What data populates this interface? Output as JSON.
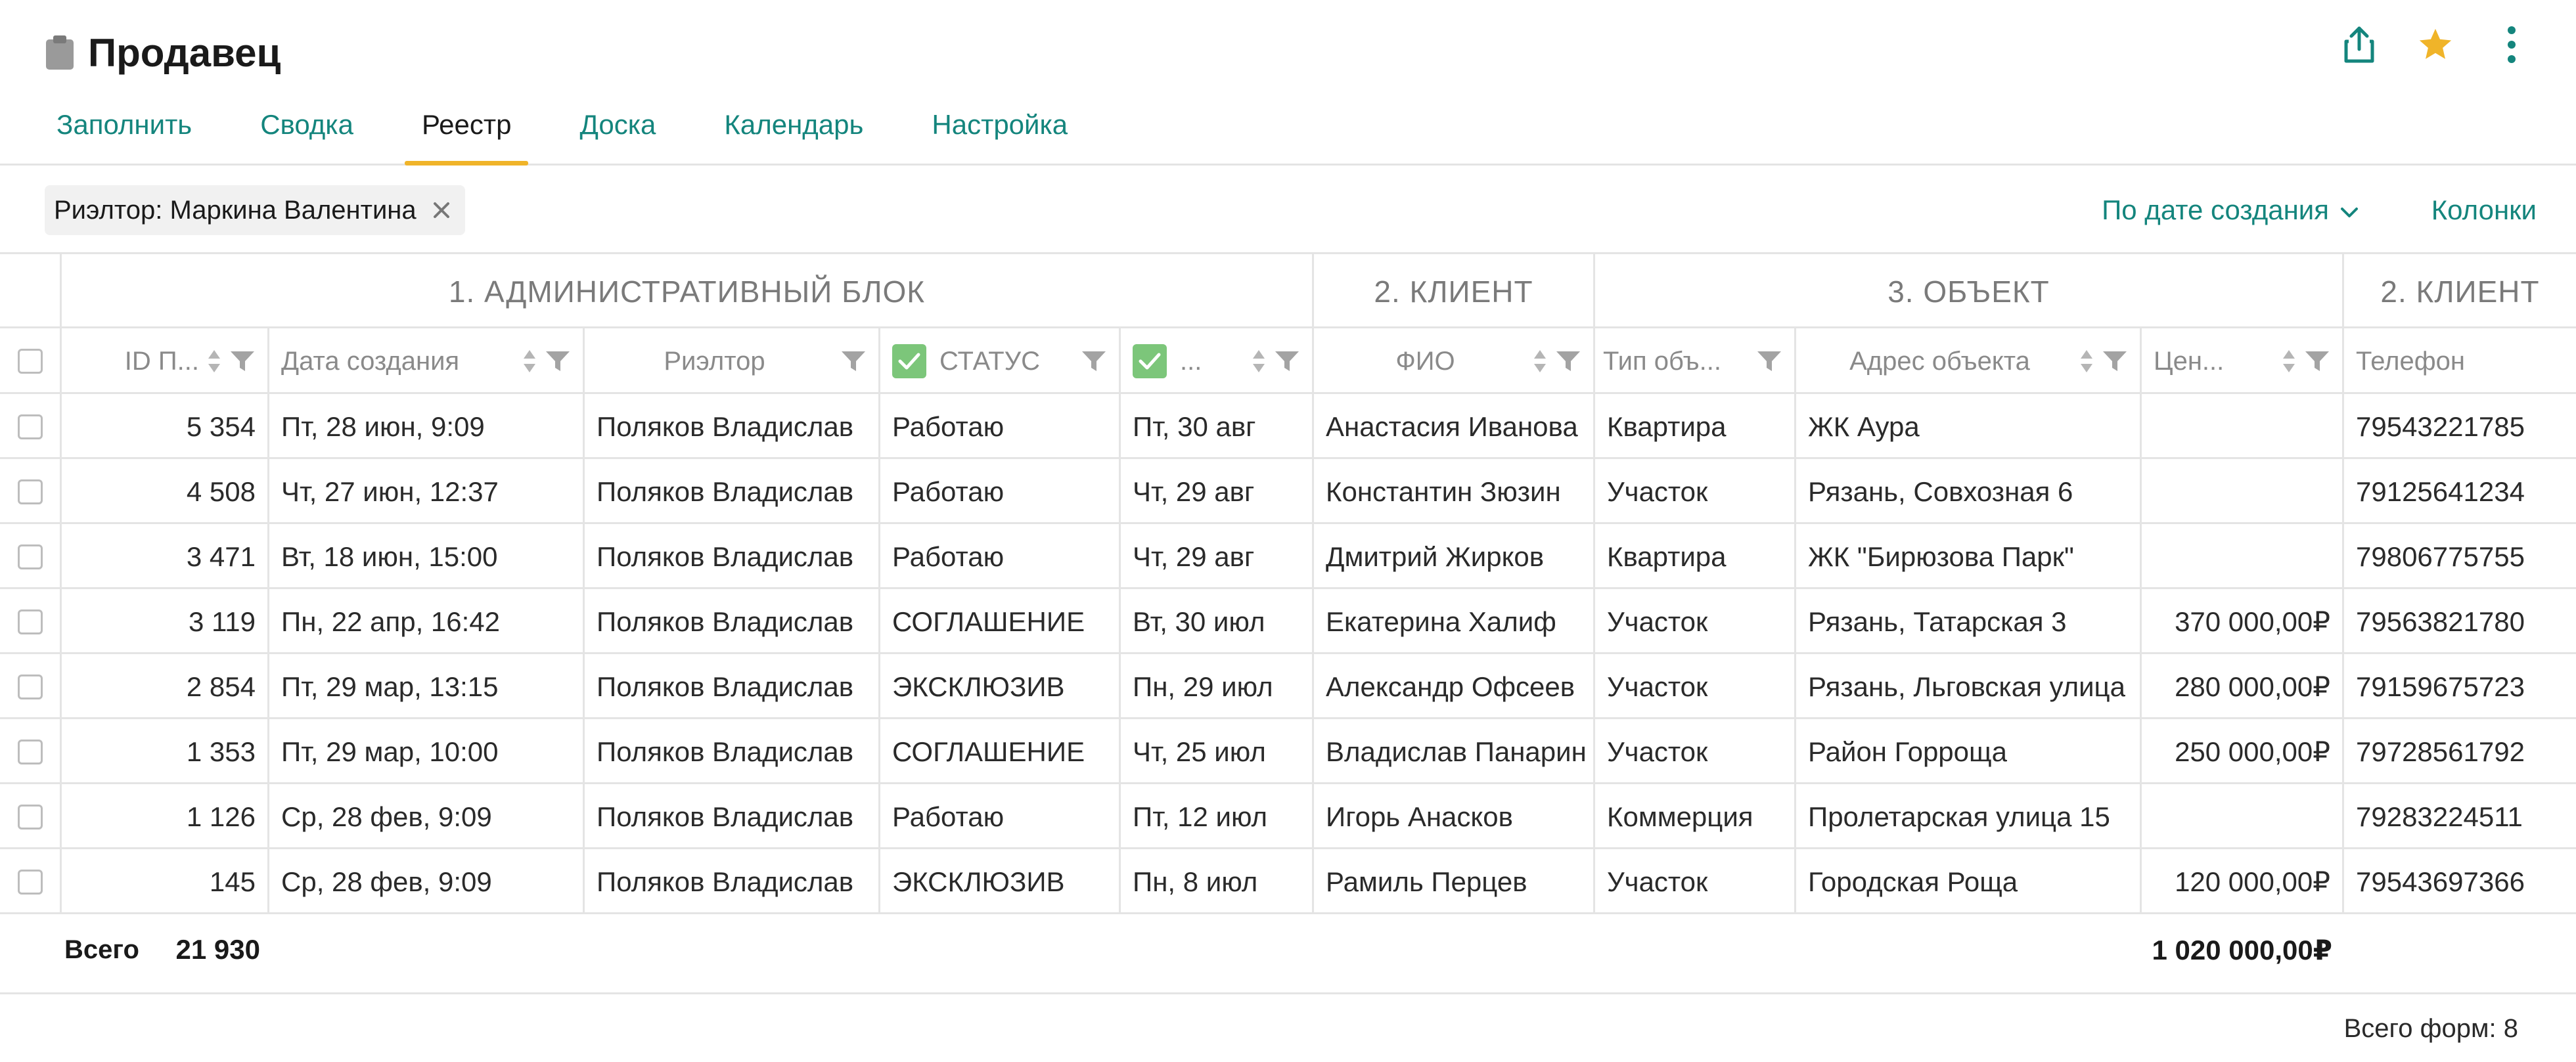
{
  "app": {
    "title": "Продавец",
    "tabs": [
      {
        "label": "Заполнить"
      },
      {
        "label": "Сводка"
      },
      {
        "label": "Реестр"
      },
      {
        "label": "Доска"
      },
      {
        "label": "Календарь"
      },
      {
        "label": "Настройка"
      }
    ],
    "active_tab": "Реестр",
    "accent_color": "#14857d",
    "tab_indicator_color": "#f0b429",
    "star_color": "#f0b429"
  },
  "toolbar": {
    "filter_chip": "Риэлтор: Маркина Валентина",
    "sort_label": "По дате создания",
    "columns_label": "Колонки"
  },
  "table": {
    "groups": [
      {
        "label": "1. АДМИНИСТРАТИВНЫЙ БЛОК"
      },
      {
        "label": "2. КЛИЕНТ"
      },
      {
        "label": "3. ОБЪЕКТ"
      },
      {
        "label": "2. КЛИЕНТ"
      }
    ],
    "columns": [
      {
        "label": "ID П..."
      },
      {
        "label": "Дата создания"
      },
      {
        "label": "Риэлтор"
      },
      {
        "label": "СТАТУС"
      },
      {
        "label": "..."
      },
      {
        "label": "ФИО"
      },
      {
        "label": "Тип объ..."
      },
      {
        "label": "Адрес объекта"
      },
      {
        "label": "Цен..."
      },
      {
        "label": "Телефон"
      }
    ],
    "rows": [
      {
        "id": "5 354",
        "created": "Пт, 28 июн, 9:09",
        "realtor": "Поляков Владислав",
        "status": "Работаю",
        "date2": "Пт, 30 авг",
        "fio": "Анастасия Иванова",
        "type": "Квартира",
        "address": "ЖК Аура",
        "price": "",
        "phone": "79543221785"
      },
      {
        "id": "4 508",
        "created": "Чт, 27 июн, 12:37",
        "realtor": "Поляков Владислав",
        "status": "Работаю",
        "date2": "Чт, 29 авг",
        "fio": "Константин Зюзин",
        "type": "Участок",
        "address": "Рязань, Совхозная 6",
        "price": "",
        "phone": "79125641234"
      },
      {
        "id": "3 471",
        "created": "Вт, 18 июн, 15:00",
        "realtor": "Поляков Владислав",
        "status": "Работаю",
        "date2": "Чт, 29 авг",
        "fio": "Дмитрий Жирков",
        "type": "Квартира",
        "address": "ЖК \"Бирюзова Парк\"",
        "price": "",
        "phone": "79806775755"
      },
      {
        "id": "3 119",
        "created": "Пн, 22 апр, 16:42",
        "realtor": "Поляков Владислав",
        "status": "СОГЛАШЕНИЕ",
        "date2": "Вт, 30 июл",
        "fio": "Екатерина Халиф",
        "type": "Участок",
        "address": "Рязань, Татарская 3",
        "price": "370 000,00₽",
        "phone": "79563821780"
      },
      {
        "id": "2 854",
        "created": "Пт, 29 мар, 13:15",
        "realtor": "Поляков Владислав",
        "status": "ЭКСКЛЮЗИВ",
        "date2": "Пн, 29 июл",
        "fio": "Александр Офсеев",
        "type": "Участок",
        "address": "Рязань, Льговская улица",
        "price": "280 000,00₽",
        "phone": "79159675723"
      },
      {
        "id": "1 353",
        "created": "Пт, 29 мар, 10:00",
        "realtor": "Поляков Владислав",
        "status": "СОГЛАШЕНИЕ",
        "date2": "Чт, 25 июл",
        "fio": "Владислав Панарин",
        "type": "Участок",
        "address": "Район Горроща",
        "price": "250 000,00₽",
        "phone": "79728561792"
      },
      {
        "id": "1 126",
        "created": "Ср, 28 фев, 9:09",
        "realtor": "Поляков Владислав",
        "status": "Работаю",
        "date2": "Пт, 12 июл",
        "fio": "Игорь Анасков",
        "type": "Коммерция",
        "address": "Пролетарская улица 15",
        "price": "",
        "phone": "79283224511"
      },
      {
        "id": "145",
        "created": "Ср, 28 фев, 9:09",
        "realtor": "Поляков Владислав",
        "status": "ЭКСКЛЮЗИВ",
        "date2": "Пн, 8 июл",
        "fio": "Рамиль Перцев",
        "type": "Участок",
        "address": "Городская Роща",
        "price": "120 000,00₽",
        "phone": "79543697366"
      }
    ]
  },
  "totals": {
    "label": "Всего",
    "id_sum": "21 930",
    "price_sum": "1 020 000,00₽"
  },
  "footer": {
    "forms_total": "Всего форм: 8"
  }
}
